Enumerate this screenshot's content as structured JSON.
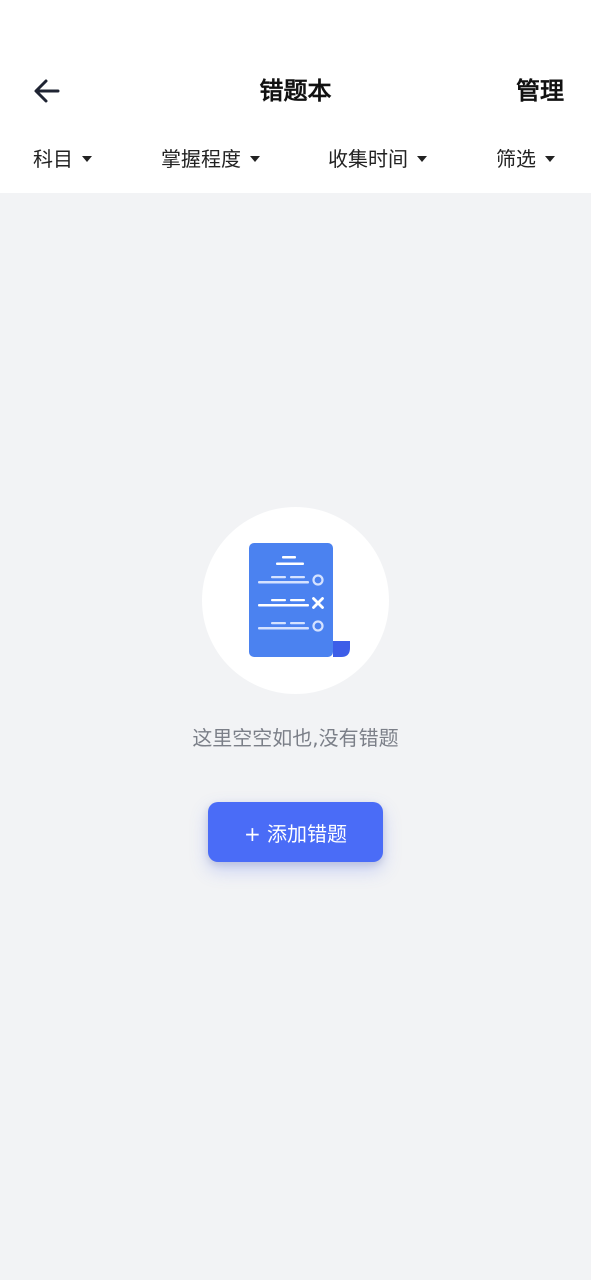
{
  "header": {
    "title": "错题本",
    "manage_label": "管理",
    "back_icon": "arrow-left-icon"
  },
  "filters": [
    {
      "label": "科目",
      "icon": "caret-down-icon"
    },
    {
      "label": "掌握程度",
      "icon": "caret-down-icon"
    },
    {
      "label": "收集时间",
      "icon": "caret-down-icon"
    },
    {
      "label": "筛选",
      "icon": "caret-down-icon"
    }
  ],
  "empty_state": {
    "illustration_icon": "mistake-document-icon",
    "message": "这里空空如也,没有错题"
  },
  "add_button": {
    "label": "+ 添加错题"
  },
  "colors": {
    "accent": "#4a6cf7",
    "background": "#f2f3f5",
    "header_background": "#ffffff",
    "text_primary": "#111111",
    "text_muted": "#7b7f88"
  }
}
